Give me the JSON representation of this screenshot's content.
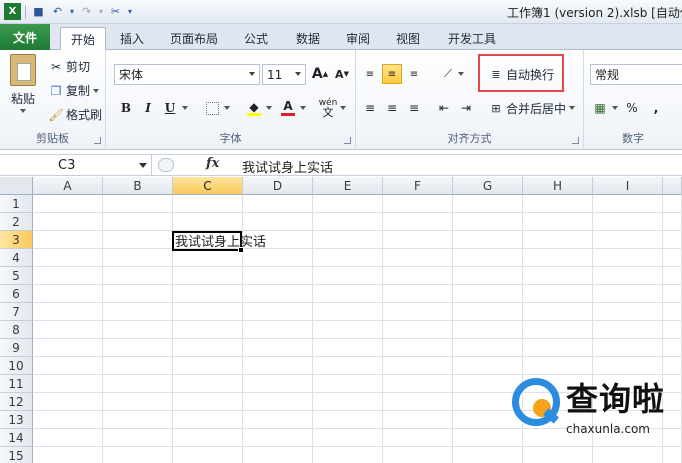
{
  "window": {
    "title": "工作簿1 (version 2).xlsb [自动保"
  },
  "tabs": [
    "文件",
    "开始",
    "插入",
    "页面布局",
    "公式",
    "数据",
    "审阅",
    "视图",
    "开发工具"
  ],
  "active_tab": "开始",
  "clipboard": {
    "paste_label": "粘贴",
    "cut_label": "剪切",
    "copy_label": "复制",
    "format_painter_label": "格式刷",
    "group_label": "剪贴板"
  },
  "font": {
    "font_name": "宋体",
    "font_size": "11",
    "bold": "B",
    "italic": "I",
    "underline": "U",
    "grow_font": "A",
    "shrink_font": "A",
    "font_color_glyph": "A",
    "phonetic_glyph": "wén",
    "group_label": "字体"
  },
  "alignment": {
    "wrap_text_label": "自动换行",
    "merge_center_label": "合并后居中",
    "group_label": "对齐方式"
  },
  "number": {
    "format": "常规",
    "percent": "%",
    "comma": ",",
    "group_label": "数字"
  },
  "formula_bar": {
    "name_box": "C3",
    "fx_label": "fx",
    "content": "我试试身上实话"
  },
  "grid": {
    "columns": [
      "A",
      "B",
      "C",
      "D",
      "E",
      "F",
      "G",
      "H",
      "I"
    ],
    "rows": [
      "1",
      "2",
      "3",
      "4",
      "5",
      "6",
      "7",
      "8",
      "9",
      "10",
      "11",
      "12",
      "13",
      "14",
      "15"
    ],
    "selected_column": "C",
    "selected_row": "3",
    "c3_value": "我试试身上实话"
  },
  "colors": {
    "file_tab": "#1e7a33",
    "highlight_border": "#e04a4a",
    "selected_header": "#f9c95a"
  },
  "watermark": {
    "brand": "查询啦",
    "url": "chaxunla.com"
  }
}
